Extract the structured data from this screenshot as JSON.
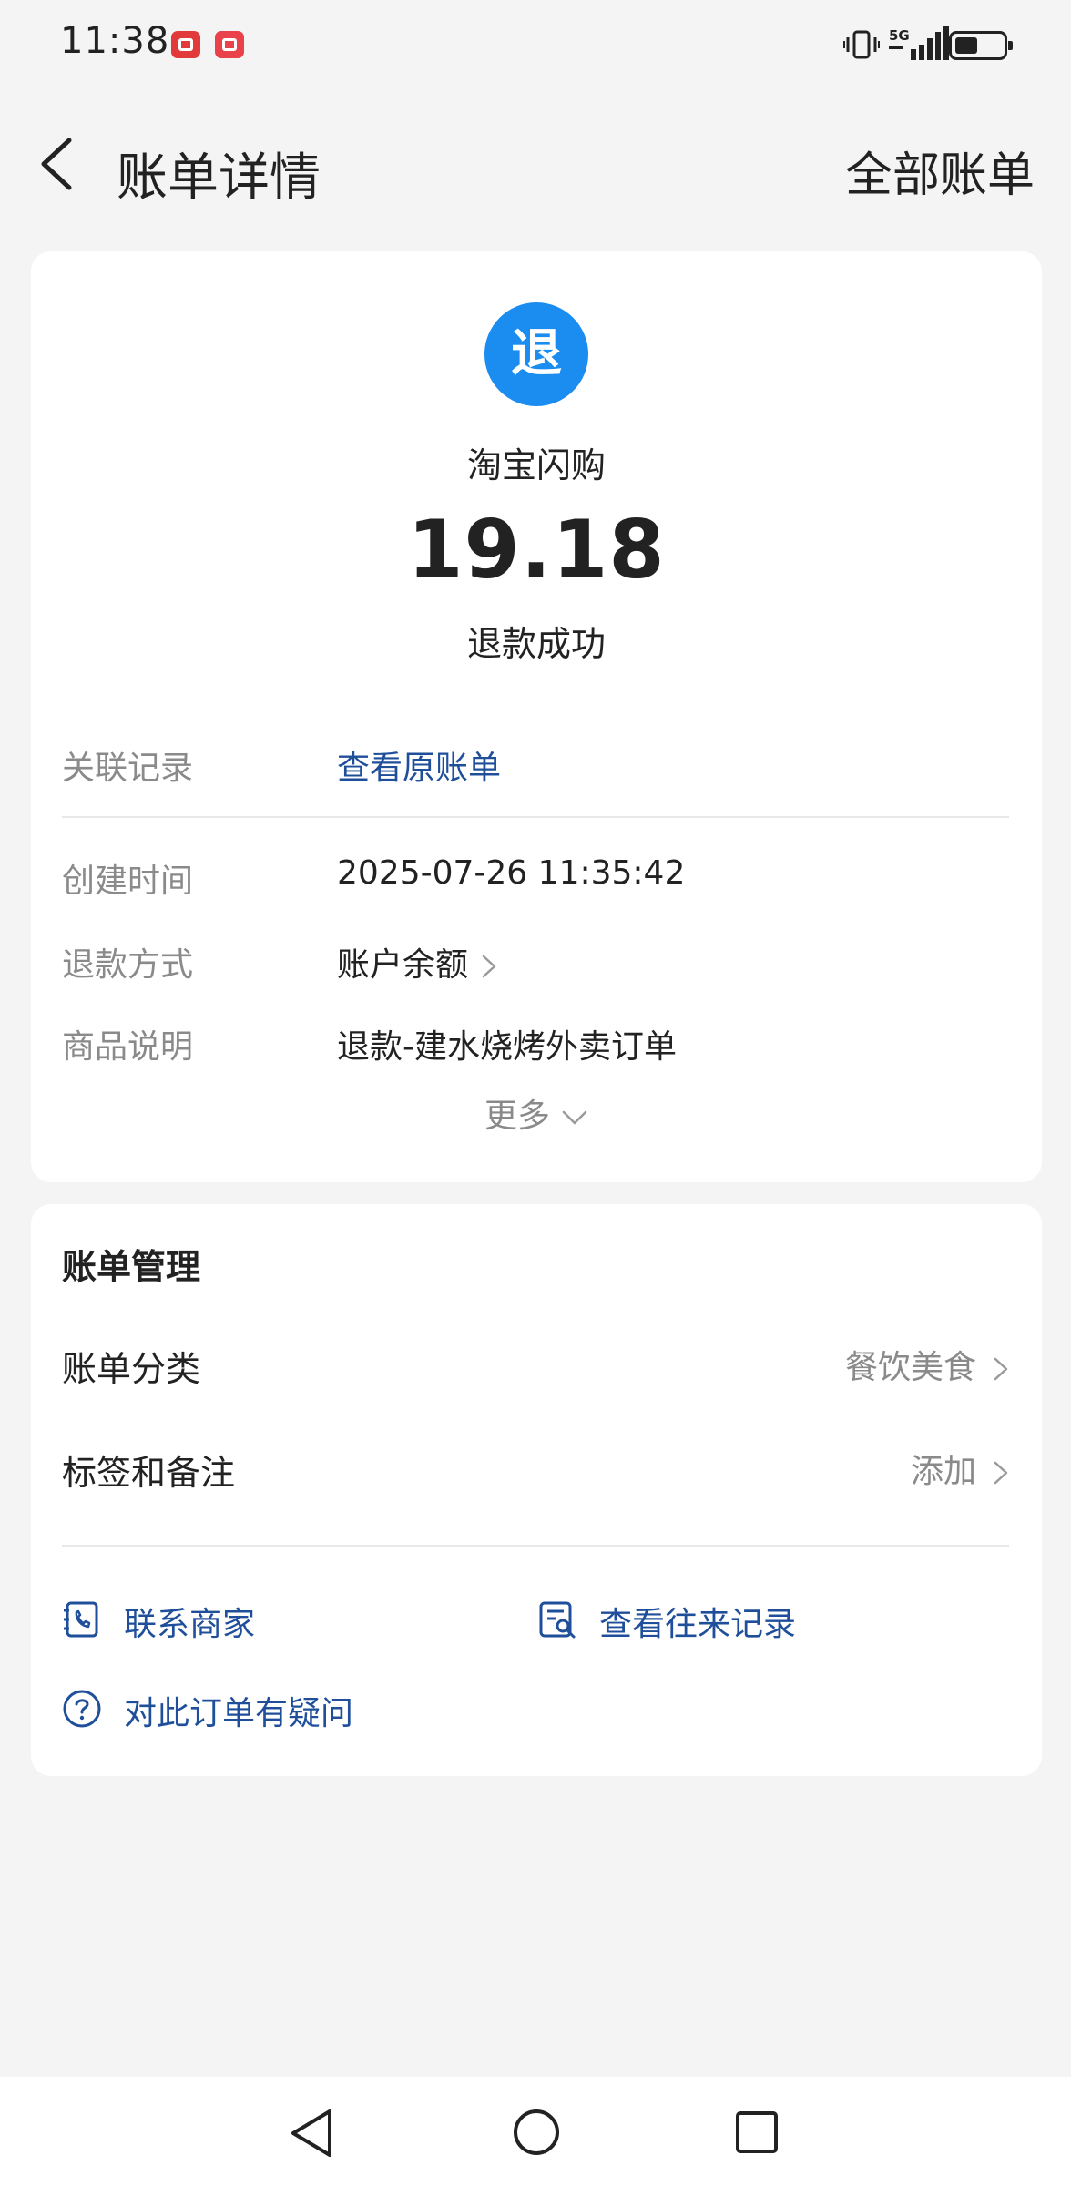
{
  "status_bar": {
    "time": "11:38",
    "icons": [
      "huawei-app-icon",
      "book-app-icon",
      "vibrate-icon",
      "5g-signal-icon",
      "battery-icon"
    ],
    "network": "5G"
  },
  "header": {
    "back_icon": "chevron-left-icon",
    "title": "账单详情",
    "all_bills": "全部账单"
  },
  "summary": {
    "badge": "退",
    "badge_color": "#1b8cf0",
    "merchant": "淘宝闪购",
    "amount": "19.18",
    "status": "退款成功"
  },
  "details": {
    "related_label": "关联记录",
    "related_value": "查看原账单",
    "created_label": "创建时间",
    "created_value": "2025-07-26 11:35:42",
    "method_label": "退款方式",
    "method_value": "账户余额",
    "desc_label": "商品说明",
    "desc_value": "退款-建水烧烤外卖订单",
    "more": "更多"
  },
  "manage": {
    "title": "账单管理",
    "category_label": "账单分类",
    "category_value": "餐饮美食",
    "tags_label": "标签和备注",
    "tags_value": "添加",
    "contact": "联系商家",
    "history": "查看往来记录",
    "question": "对此订单有疑问"
  },
  "colors": {
    "link": "#1f4f9a",
    "background": "#f4f4f4",
    "muted": "#8a8a8a"
  }
}
